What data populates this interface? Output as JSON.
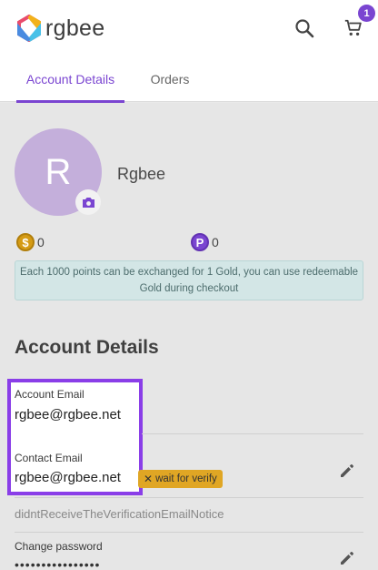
{
  "header": {
    "logo_text": "rgbee",
    "cart_count": "1",
    "search_icon": "search-icon",
    "cart_icon": "cart-icon"
  },
  "tabs": [
    {
      "label": "Account Details",
      "active": true
    },
    {
      "label": "Orders",
      "active": false
    }
  ],
  "profile": {
    "avatar_initial": "R",
    "name": "Rgbee",
    "gold": "0",
    "points": "0",
    "gold_icon_glyph": "$",
    "points_icon_glyph": "P",
    "points_notice": "Each 1000 points can be exchanged for 1 Gold, you can use redeemable Gold during checkout"
  },
  "account": {
    "section_title": "Account Details",
    "account_email_label": "Account Email",
    "account_email": "rgbee@rgbee.net",
    "contact_email_label": "Contact Email",
    "contact_email": "rgbee@rgbee.net",
    "verify_status": "wait for verify",
    "verify_notice": "didntReceiveTheVerificationEmailNotice",
    "change_password_label": "Change password",
    "password_mask": "••••••••••••••••"
  },
  "colors": {
    "accent": "#7a45d1",
    "highlight": "#8a3ee8",
    "badge": "#e0a624"
  }
}
